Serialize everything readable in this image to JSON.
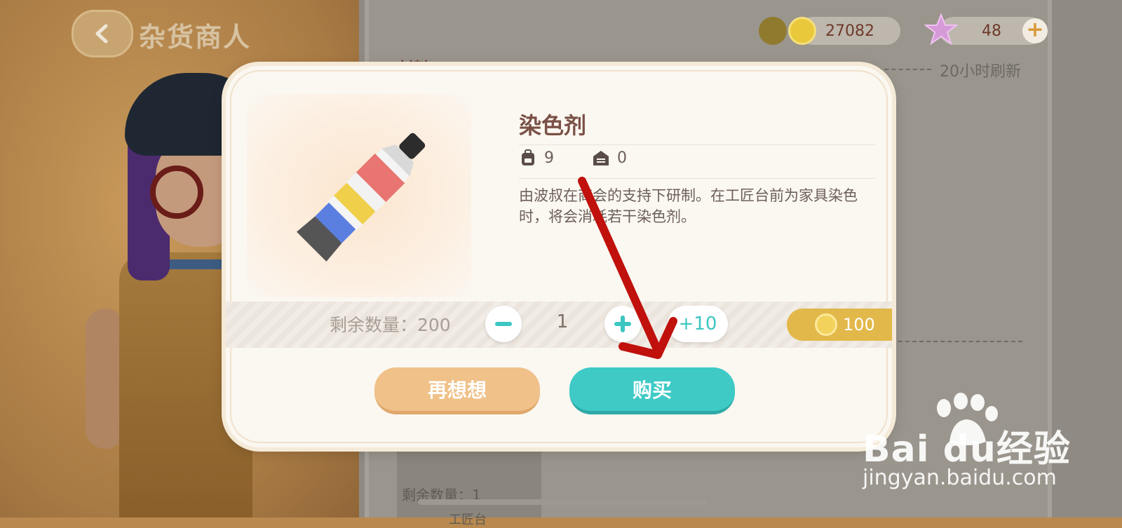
{
  "header": {
    "title": "杂货商人",
    "coins": "27082",
    "stars": "48",
    "add_label": "+"
  },
  "background": {
    "category_label": "材料",
    "refresh_text": "20小时刷新",
    "bottom_item_remain": "剩余数量：1",
    "bottom_item_name": "工匠台"
  },
  "dialog": {
    "item_name": "染色剂",
    "backpack_count": "9",
    "warehouse_count": "0",
    "description": "由波叔在商会的支持下研制。在工匠台前为家具染色时，将会消耗若干染色剂。",
    "remaining_label": "剩余数量：200",
    "quantity": "1",
    "plus10_label": "+10",
    "price": "100",
    "cancel_label": "再想想",
    "buy_label": "购买"
  },
  "watermark": {
    "brand": "Bai  du经验",
    "url": "jingyan.baidu.com"
  },
  "colors": {
    "buy_button": "#3fcac6",
    "cancel_button": "#f0c189",
    "price_tag": "#e2b84a",
    "title_text": "#7a5146",
    "annotation_arrow": "#c0110c"
  }
}
